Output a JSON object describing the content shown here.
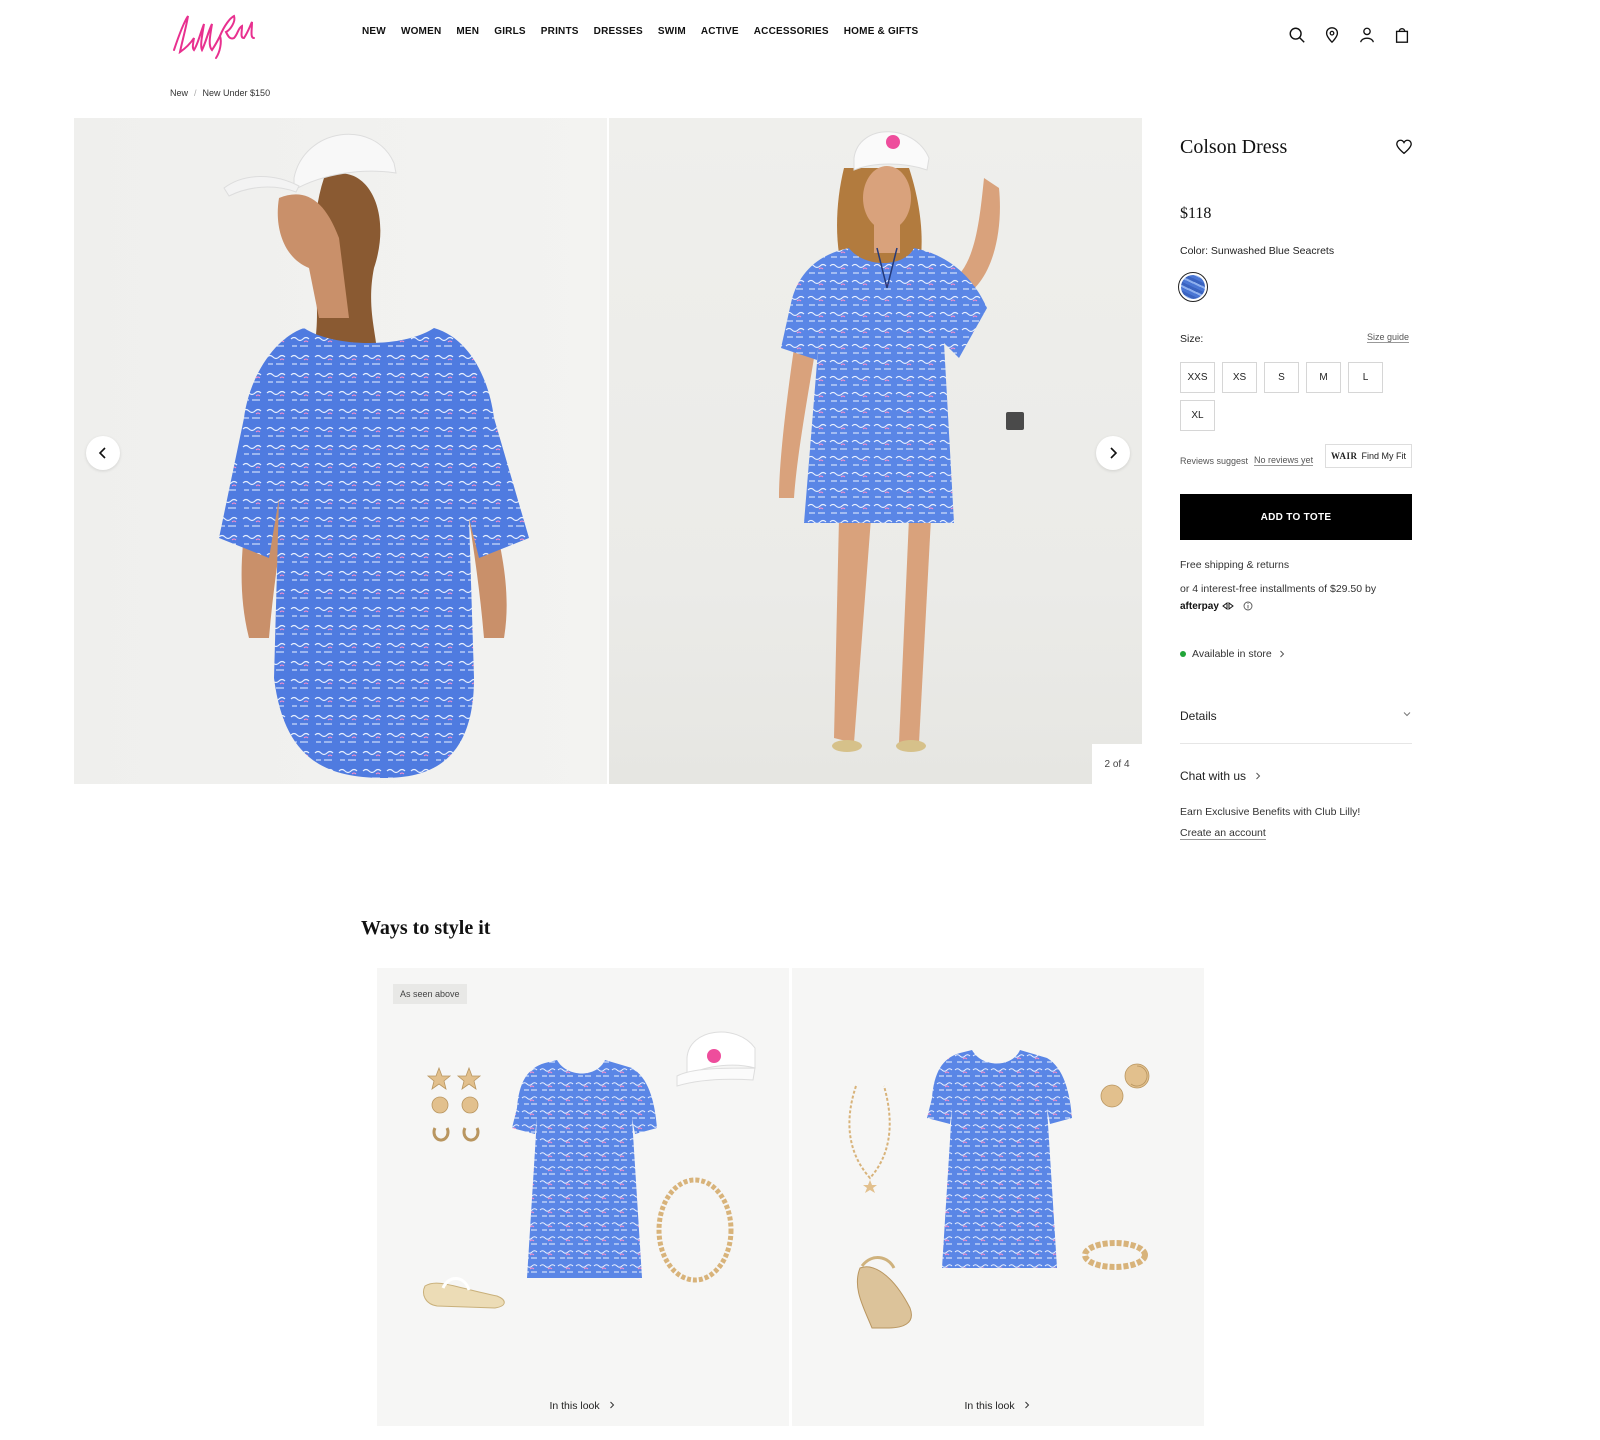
{
  "header": {
    "logo_text": "Lilly Pulitzer",
    "nav": [
      "New",
      "Women",
      "Men",
      "Girls",
      "Prints",
      "Dresses",
      "Swim",
      "Active",
      "Accessories",
      "Home & Gifts"
    ],
    "icons": [
      "search-icon",
      "location-icon",
      "account-icon",
      "bag-icon"
    ]
  },
  "breadcrumb": {
    "items": [
      "New",
      "New Under $150"
    ],
    "separator": "/"
  },
  "gallery": {
    "counter": "2 of 4"
  },
  "product": {
    "title": "Colson Dress",
    "price": "$118",
    "color_label": "Color: Sunwashed Blue Seacrets",
    "size_label": "Size:",
    "size_guide": "Size guide",
    "sizes": [
      "XXS",
      "XS",
      "S",
      "M",
      "L",
      "XL"
    ],
    "reviews_suggest": "Reviews suggest",
    "no_reviews": "No reviews yet",
    "fit_brand": "WAIR",
    "fit_button": "Find My Fit",
    "add_to_tote": "ADD TO TOTE",
    "shipping": "Free shipping & returns",
    "installments": "or 4 interest-free installments of $29.50 by",
    "afterpay": "afterpay",
    "available": "Available in store",
    "details": "Details",
    "chat": "Chat with us",
    "earn": "Earn Exclusive Benefits with Club Lilly!",
    "create_account": "Create an account",
    "accent_color": "#000000",
    "available_color": "#21a538"
  },
  "ways": {
    "title": "Ways to style it",
    "looks": [
      {
        "badge": "As seen above",
        "cta": "In this look"
      },
      {
        "badge": "",
        "cta": "In this look"
      }
    ]
  }
}
